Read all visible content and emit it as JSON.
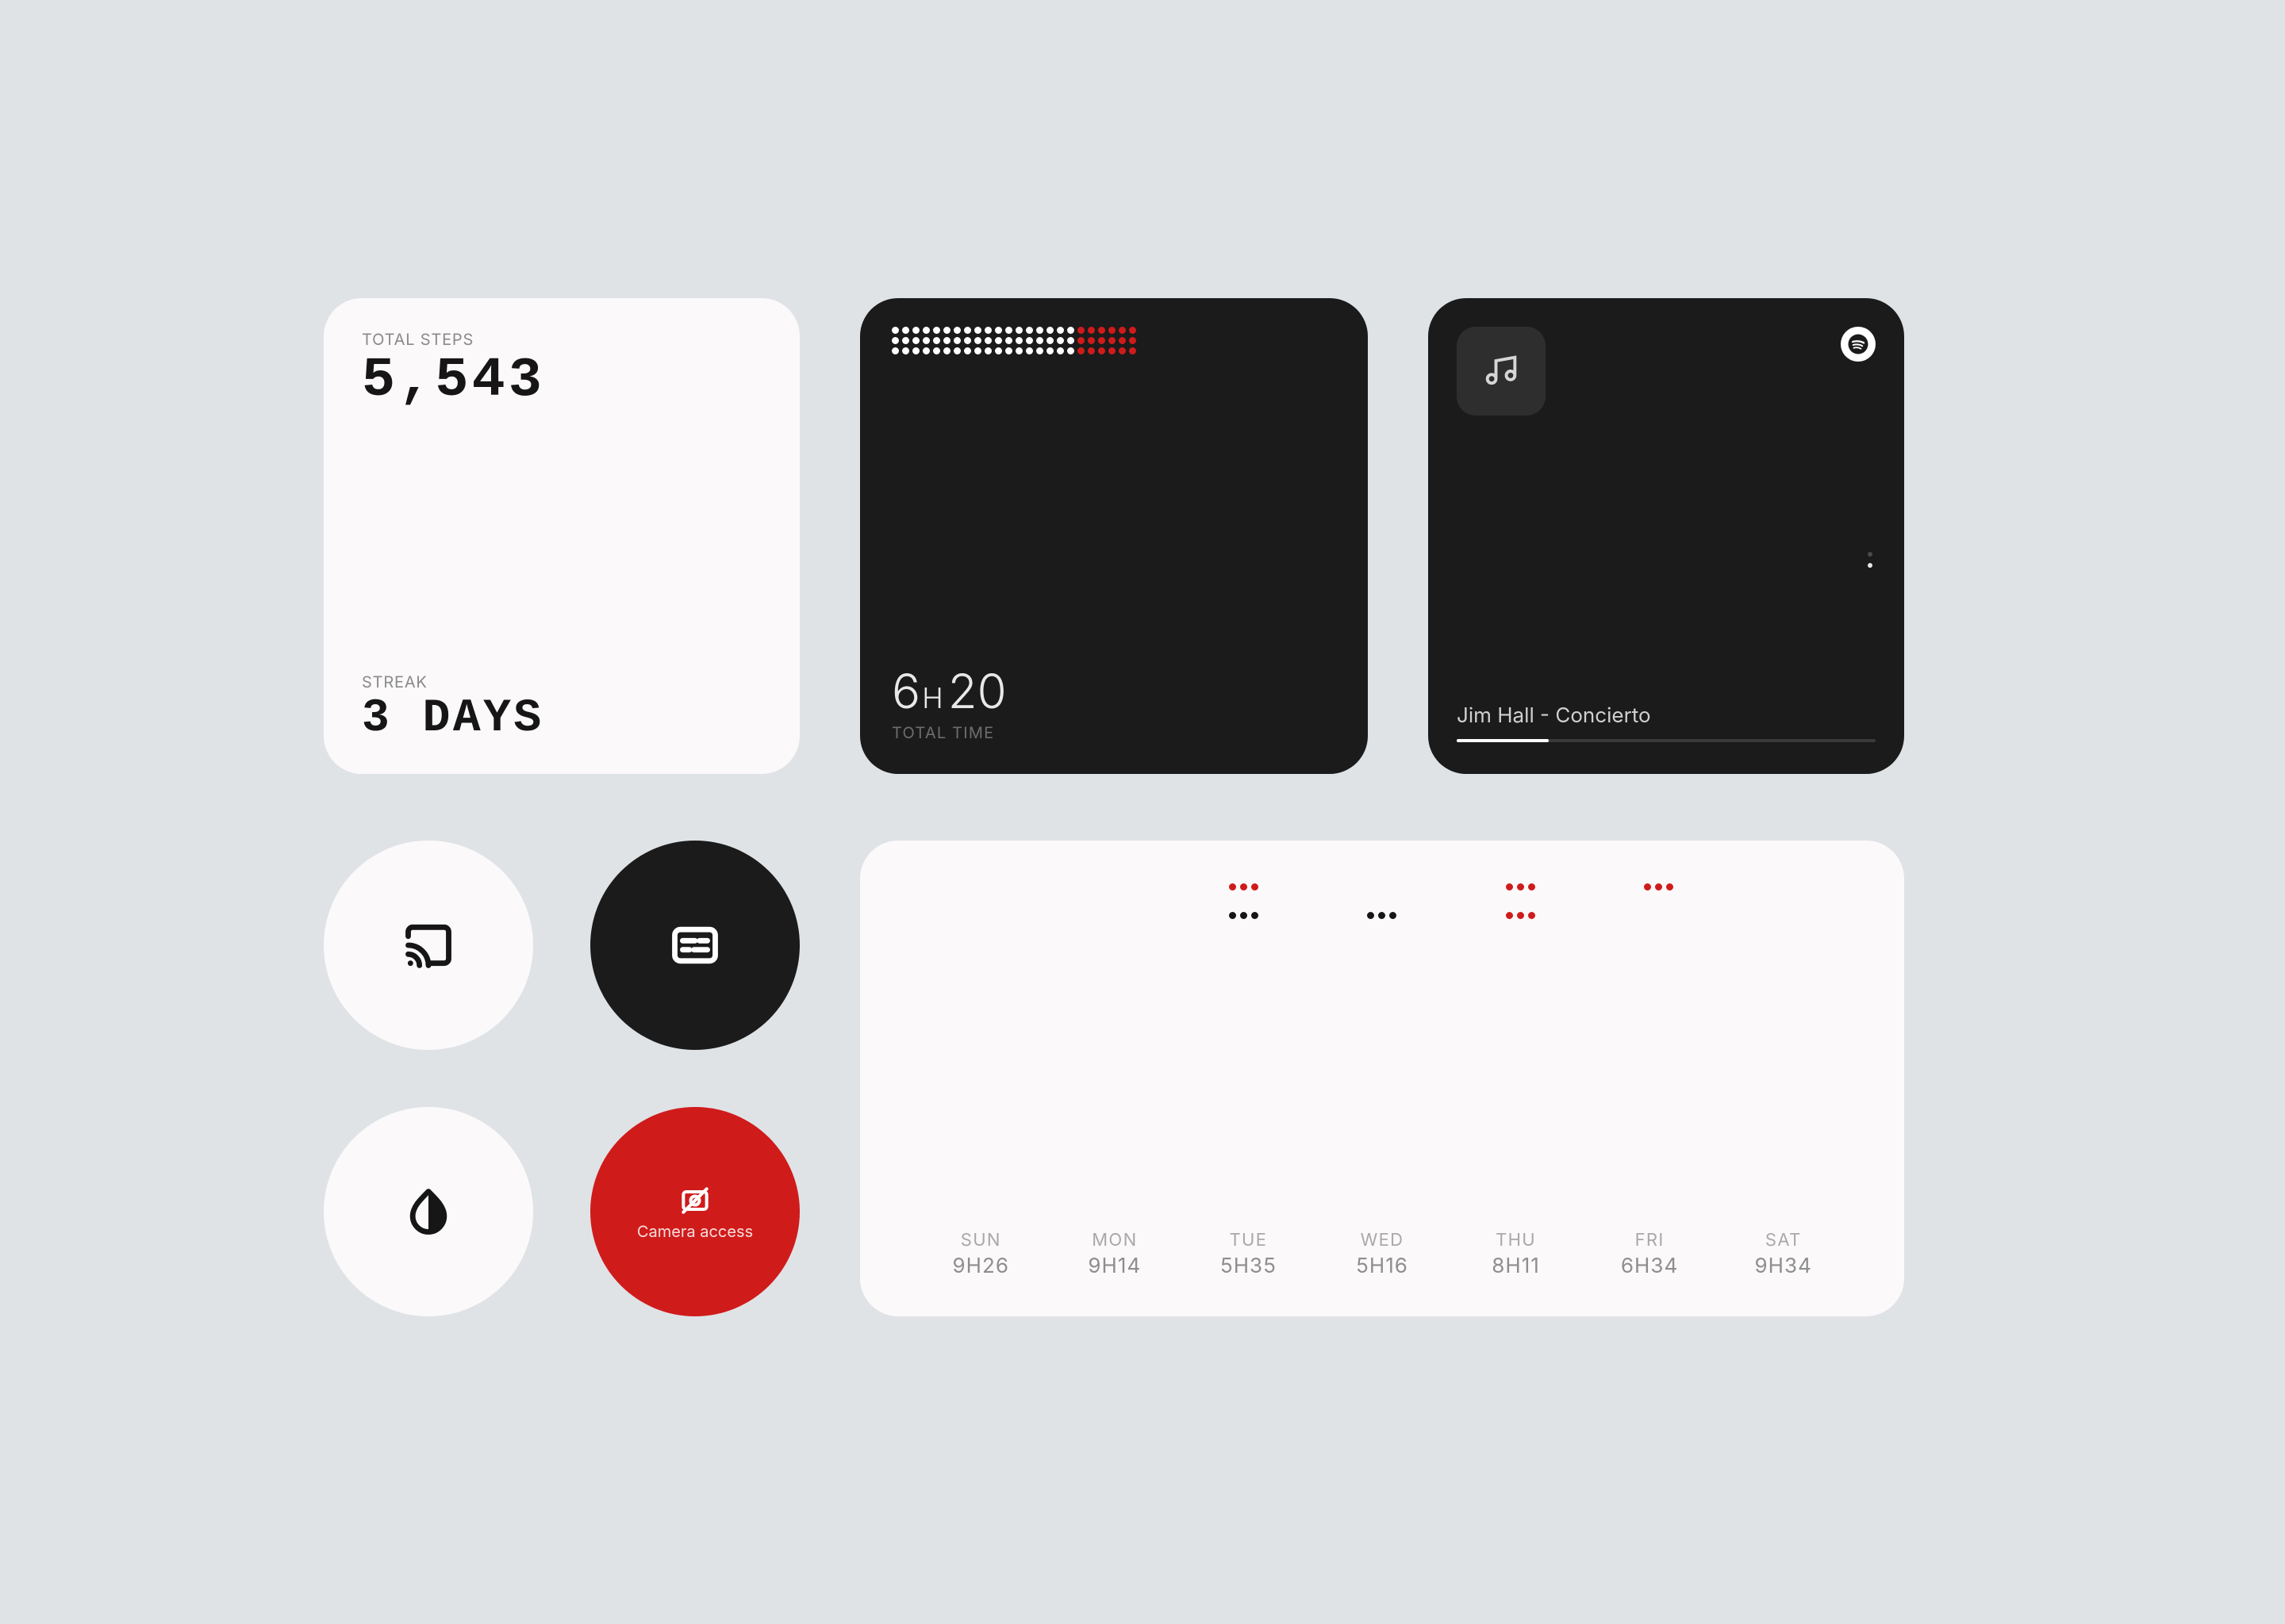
{
  "colors": {
    "accent": "#d01b1b",
    "panel_light": "#fbf9fa",
    "panel_dark": "#1b1b1b",
    "bg": "#dfe3e6"
  },
  "steps": {
    "label_total": "TOTAL STEPS",
    "value": "5,543",
    "label_streak": "STREAK",
    "streak": "3 DAYS"
  },
  "time": {
    "hours_value": "6",
    "hours_unit": "H",
    "minutes_value": "20",
    "label": "TOTAL TIME",
    "dot_grid": {
      "rows": 3,
      "cols": 24,
      "red_last": 6
    }
  },
  "music": {
    "album_icon": "music-note-icon",
    "provider_icon": "spotify-icon",
    "track": "Jim Hall - Concierto",
    "progress_pct": 22,
    "page_indicator": {
      "count": 2,
      "selected": 1
    }
  },
  "buttons": {
    "cast_icon": "cast-icon",
    "cc_icon": "closed-captions-icon",
    "contrast_icon": "contrast-icon",
    "camera_icon": "camera-off-icon",
    "camera_label": "Camera access"
  },
  "chart_data": {
    "type": "bar",
    "title": "",
    "xlabel": "",
    "ylabel": "",
    "ylim": [
      0,
      2
    ],
    "categories": [
      "SUN",
      "MON",
      "TUE",
      "WED",
      "THU",
      "FRI",
      "SAT"
    ],
    "labels": [
      "9H26",
      "9H14",
      "5H35",
      "5H16",
      "8H11",
      "6H34",
      "9H34"
    ],
    "series": [
      {
        "name": "upper-row (red dot-set)",
        "values": [
          0,
          0,
          1,
          0,
          1,
          1,
          0
        ]
      },
      {
        "name": "lower-row (dot-set)",
        "values": [
          0,
          0,
          1,
          1,
          1,
          0,
          0
        ]
      }
    ],
    "lower_row_colors": [
      "",
      "",
      "dark",
      "dark",
      "red",
      "",
      ""
    ]
  }
}
